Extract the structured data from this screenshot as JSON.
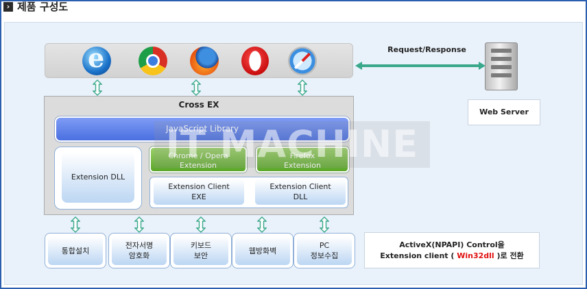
{
  "header": {
    "title": "제품 구성도",
    "icon": "chevron-right-icon"
  },
  "browsers": [
    {
      "name": "ie",
      "icon": "internet-explorer-icon"
    },
    {
      "name": "chrome",
      "icon": "chrome-icon"
    },
    {
      "name": "firefox",
      "icon": "firefox-icon"
    },
    {
      "name": "opera",
      "icon": "opera-icon"
    },
    {
      "name": "safari",
      "icon": "safari-icon"
    }
  ],
  "connection": {
    "label": "Request/Response"
  },
  "server": {
    "icon": "server-icon",
    "label": "Web Server"
  },
  "cross_ex": {
    "title": "Cross  EX",
    "js_library": "JavaScript  Library",
    "extension_dll": "Extension DLL",
    "chrome_opera_line1": "Chrome  /  Opera",
    "chrome_opera_line2": "Extension",
    "firefox_line1": "Firefox",
    "firefox_line2": "Extension",
    "client_exe_line1": "Extension Client",
    "client_exe_line2": "EXE",
    "client_dll_line1": "Extension Client",
    "client_dll_line2": "DLL"
  },
  "features": [
    {
      "line1": "통합설치",
      "line2": ""
    },
    {
      "line1": "전자서명",
      "line2": "암호화"
    },
    {
      "line1": "키보드",
      "line2": "보안"
    },
    {
      "line1": "웹방화벽",
      "line2": ""
    },
    {
      "line1": "PC",
      "line2": "정보수집"
    }
  ],
  "note": {
    "line1": "ActiveX(NPAPI) Control을",
    "line2_prefix": "Extension client ( ",
    "line2_highlight": "Win32dll",
    "line2_suffix": " )로 전환"
  },
  "watermark": "IT MACHINE",
  "colors": {
    "frame": "#2a5fb0",
    "arrow": "#3aa88a",
    "js_blue": "#4a6fe0",
    "green": "#5aa62a",
    "highlight_red": "#e01010"
  }
}
